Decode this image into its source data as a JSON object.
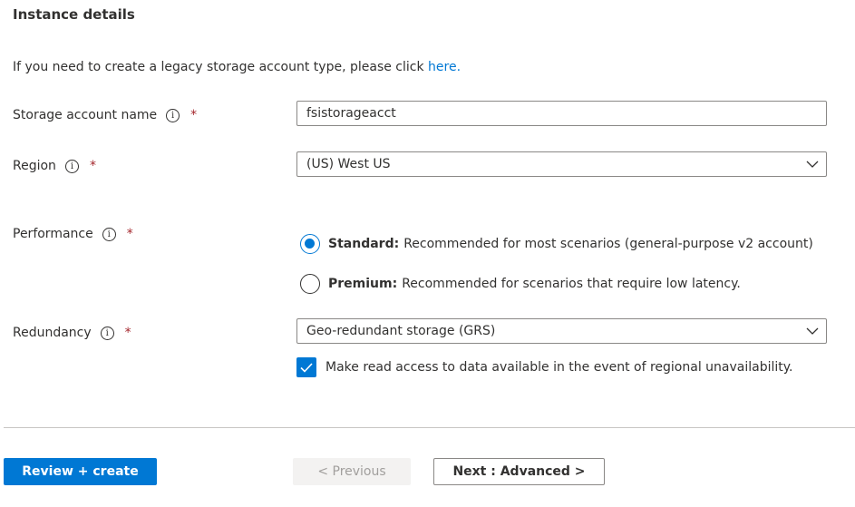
{
  "section_title": "Instance details",
  "legacy": {
    "text": "If you need to create a legacy storage account type, please click ",
    "link": "here."
  },
  "fields": {
    "storage_account_name": {
      "label": "Storage account name",
      "required": "*",
      "value": "fsistorageacct"
    },
    "region": {
      "label": "Region",
      "required": "*",
      "value": "(US) West US"
    },
    "performance": {
      "label": "Performance",
      "required": "*",
      "options": [
        {
          "bold": "Standard:",
          "text": "Recommended for most scenarios (general-purpose v2 account)",
          "checked": true
        },
        {
          "bold": "Premium:",
          "text": "Recommended for scenarios that require low latency.",
          "checked": false
        }
      ]
    },
    "redundancy": {
      "label": "Redundancy",
      "required": "*",
      "value": "Geo-redundant storage (GRS)",
      "read_access_label": "Make read access to data available in the event of regional unavailability.",
      "read_access_checked": true
    }
  },
  "info_icon_glyph": "i",
  "footer": {
    "review_create": "Review + create",
    "previous": "< Previous",
    "next": "Next : Advanced >"
  },
  "colors": {
    "accent": "#0078d4",
    "required": "#a4262c"
  }
}
